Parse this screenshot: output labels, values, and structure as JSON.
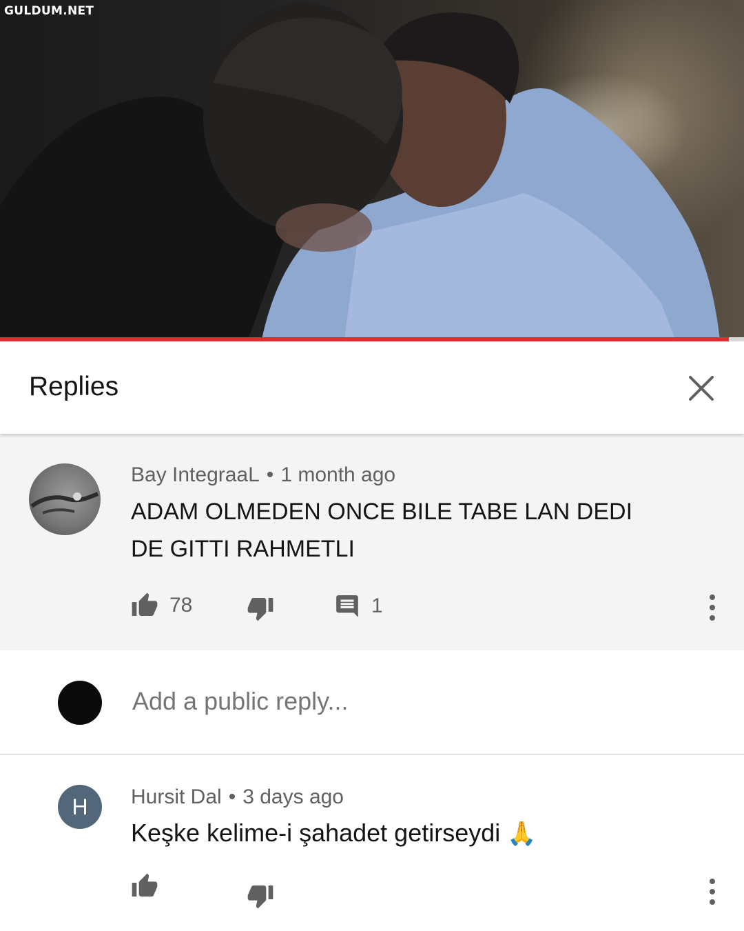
{
  "watermark": "GULDUM.NET",
  "video": {
    "progress_fraction": 0.98
  },
  "header": {
    "title": "Replies",
    "close_icon": "close-icon"
  },
  "main_comment": {
    "author": "Bay IntegraaL",
    "separator": "•",
    "time": "1 month ago",
    "text_line1": "ADAM OLMEDEN ONCE BILE TABE LAN DEDI",
    "text_line2": "DE GITTI RAHMETLI",
    "likes": "78",
    "replies": "1"
  },
  "reply_box": {
    "placeholder": "Add a public reply..."
  },
  "reply": {
    "avatar_letter": "H",
    "author": "Hursit Dal",
    "separator": "•",
    "time": "3 days ago",
    "text": "Keşke kelime-i şahadet getirseydi",
    "emoji": "🙏"
  },
  "colors": {
    "progress": "#e02d2d",
    "letter_avatar": "#52677a",
    "comment_bg": "#f4f4f4",
    "meta_text": "#606060"
  }
}
